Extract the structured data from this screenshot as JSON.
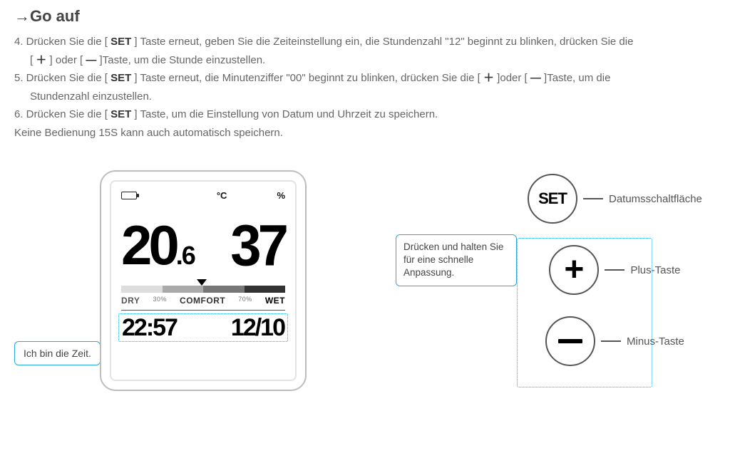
{
  "heading": "→Go auf",
  "steps": {
    "s4_pre": "4. Drücken Sie die [ ",
    "s4_set": "SET",
    "s4_mid": " ] Taste erneut, geben Sie die Zeiteinstellung ein, die Stundenzahl \"12\" beginnt zu blinken, drücken Sie die",
    "s4_line2_pre": "[ ",
    "s4_plus": "＋",
    "s4_line2_mid": " ] oder [ ",
    "s4_minus": "—",
    "s4_line2_end": " ]Taste, um die Stunde einzustellen.",
    "s5_pre": "5. Drücken Sie die [ ",
    "s5_set": "SET",
    "s5_mid": " ] Taste erneut, die Minutenziffer \"00\" beginnt zu blinken, drücken Sie die [ ",
    "s5_plus": "＋",
    "s5_mid2": " ]oder [ ",
    "s5_minus": "—",
    "s5_end": " ]Taste, um die",
    "s5_line2": "Stundenzahl einzustellen.",
    "s6_pre": "6. Drücken Sie die [ ",
    "s6_set": "SET",
    "s6_end": " ] Taste, um die Einstellung von Datum und Uhrzeit zu speichern.",
    "note": "Keine Bedienung 15S kann auch automatisch speichern."
  },
  "device": {
    "unit_temp": "°C",
    "unit_hum": "%",
    "temp_int": "20",
    "temp_dec": ".6",
    "humidity": "37",
    "dry": "DRY",
    "pct30": "30%",
    "comfort": "COMFORT",
    "pct70": "70%",
    "wet": "WET",
    "time": "22:57",
    "date": "12/10"
  },
  "callouts": {
    "time_label": "Ich bin die Zeit.",
    "hold_label": "Drücken und halten Sie für eine schnelle Anpassung."
  },
  "buttons": {
    "set_text": "SET",
    "set_label": "Datumsschaltfläche",
    "plus_text": "+",
    "plus_label": "Plus-Taste",
    "minus_label": "Minus-Taste"
  }
}
